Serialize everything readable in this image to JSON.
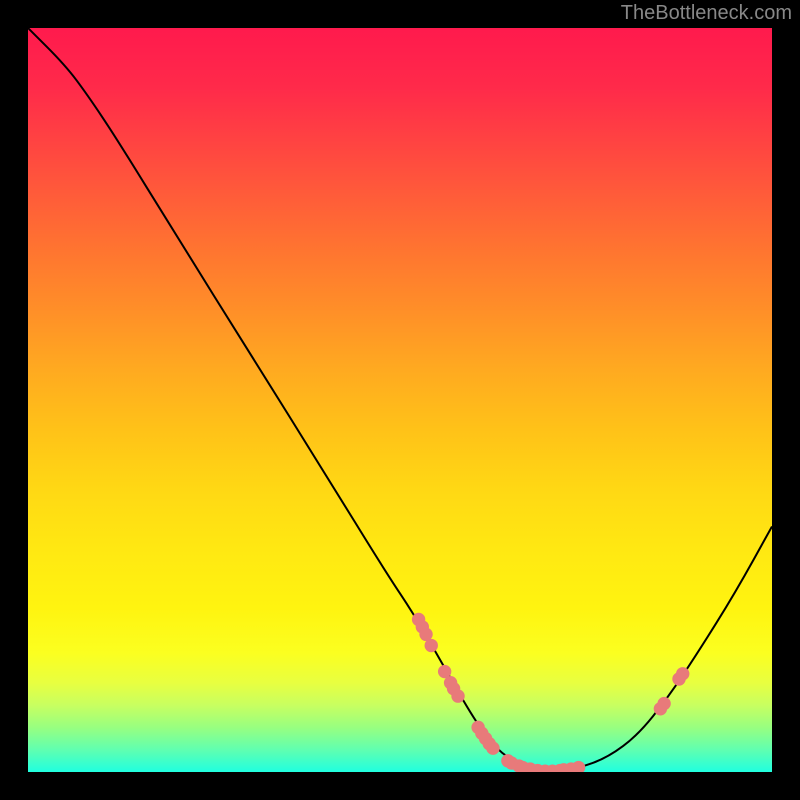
{
  "watermark": "TheBottleneck.com",
  "chart_data": {
    "type": "line",
    "title": "",
    "xlabel": "",
    "ylabel": "",
    "xlim": [
      0,
      100
    ],
    "ylim": [
      0,
      100
    ],
    "curve": [
      {
        "x": 0,
        "y": 100
      },
      {
        "x": 5,
        "y": 95
      },
      {
        "x": 8,
        "y": 91
      },
      {
        "x": 12,
        "y": 85
      },
      {
        "x": 20,
        "y": 72
      },
      {
        "x": 30,
        "y": 56
      },
      {
        "x": 40,
        "y": 40
      },
      {
        "x": 48,
        "y": 27
      },
      {
        "x": 52,
        "y": 21
      },
      {
        "x": 56,
        "y": 14
      },
      {
        "x": 60,
        "y": 7
      },
      {
        "x": 63,
        "y": 3
      },
      {
        "x": 66,
        "y": 1
      },
      {
        "x": 70,
        "y": 0
      },
      {
        "x": 74,
        "y": 0.5
      },
      {
        "x": 78,
        "y": 2
      },
      {
        "x": 82,
        "y": 5
      },
      {
        "x": 86,
        "y": 10
      },
      {
        "x": 90,
        "y": 16
      },
      {
        "x": 95,
        "y": 24
      },
      {
        "x": 100,
        "y": 33
      }
    ],
    "markers": [
      {
        "x": 52.5,
        "y": 20.5
      },
      {
        "x": 53.0,
        "y": 19.5
      },
      {
        "x": 53.5,
        "y": 18.5
      },
      {
        "x": 54.2,
        "y": 17.0
      },
      {
        "x": 56.0,
        "y": 13.5
      },
      {
        "x": 56.8,
        "y": 12.0
      },
      {
        "x": 57.2,
        "y": 11.2
      },
      {
        "x": 57.8,
        "y": 10.2
      },
      {
        "x": 60.5,
        "y": 6.0
      },
      {
        "x": 61.0,
        "y": 5.2
      },
      {
        "x": 61.5,
        "y": 4.5
      },
      {
        "x": 62.0,
        "y": 3.8
      },
      {
        "x": 62.5,
        "y": 3.2
      },
      {
        "x": 64.5,
        "y": 1.5
      },
      {
        "x": 65.0,
        "y": 1.2
      },
      {
        "x": 66.0,
        "y": 0.8
      },
      {
        "x": 66.5,
        "y": 0.6
      },
      {
        "x": 67.5,
        "y": 0.4
      },
      {
        "x": 68.5,
        "y": 0.2
      },
      {
        "x": 69.5,
        "y": 0.1
      },
      {
        "x": 70.5,
        "y": 0.1
      },
      {
        "x": 71.5,
        "y": 0.2
      },
      {
        "x": 72.0,
        "y": 0.3
      },
      {
        "x": 73.0,
        "y": 0.4
      },
      {
        "x": 74.0,
        "y": 0.6
      },
      {
        "x": 85.0,
        "y": 8.5
      },
      {
        "x": 85.5,
        "y": 9.2
      },
      {
        "x": 87.5,
        "y": 12.5
      },
      {
        "x": 88.0,
        "y": 13.2
      }
    ],
    "marker_color": "#e87a7a",
    "curve_color": "#000000"
  }
}
